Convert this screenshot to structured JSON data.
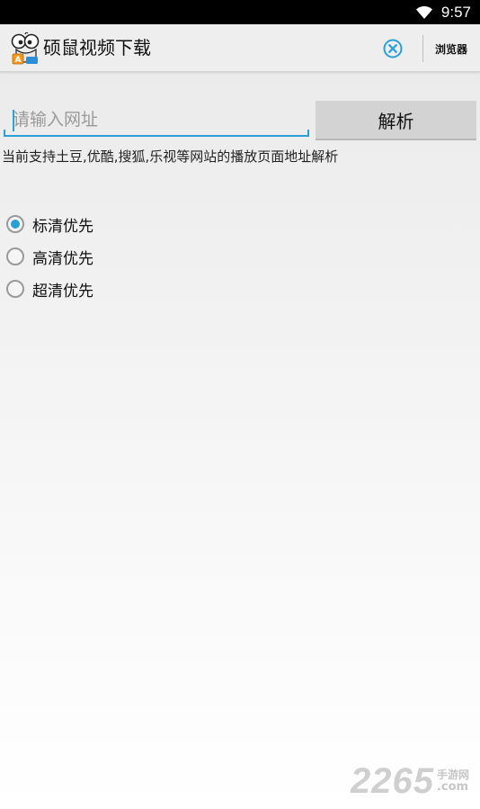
{
  "status_bar": {
    "time": "9:57",
    "wifi_icon": "wifi-icon"
  },
  "action_bar": {
    "title": "硕鼠视频下载",
    "logo_icon": "mouse-logo-icon",
    "clear_icon": "clear-circle-icon",
    "browser_label": "浏览器"
  },
  "form": {
    "url_placeholder": "请输入网址",
    "url_value": "",
    "parse_label": "解析",
    "support_text": "当前支持土豆,优酷,搜狐,乐视等网站的播放页面地址解析"
  },
  "quality": {
    "options": [
      {
        "label": "标清优先",
        "checked": true
      },
      {
        "label": "高清优先",
        "checked": false
      },
      {
        "label": "超清优先",
        "checked": false
      }
    ]
  },
  "watermark": {
    "number": "2265",
    "cn": "手游网",
    "domain": ".com"
  },
  "colors": {
    "accent": "#2aa0d6",
    "status_bar": "#000000",
    "action_bar": "#eeeeee",
    "button": "#d3d3d3"
  }
}
